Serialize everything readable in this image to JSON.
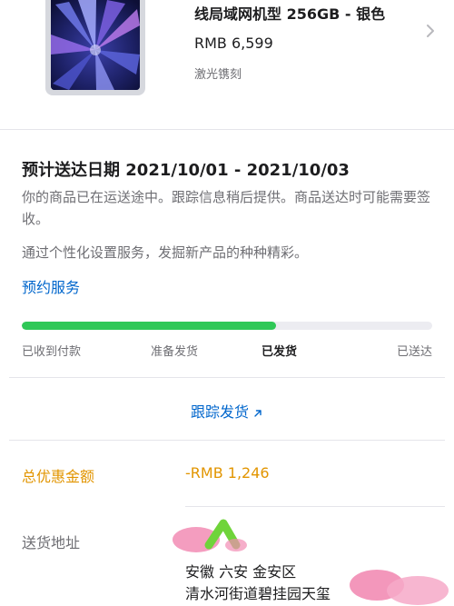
{
  "product": {
    "name": "线局域网机型 256GB - 银色",
    "price": "RMB 6,599",
    "engraving": "激光镌刻"
  },
  "delivery": {
    "title": "预计送达日期 2021/10/01 - 2021/10/03",
    "message": "你的商品已在运送途中。跟踪信息稍后提供。商品送达时可能需要签收。",
    "promo": "通过个性化设置服务，发掘新产品的种种精彩。",
    "service_link": "预约服务"
  },
  "progress": {
    "steps": [
      "已收到付款",
      "准备发货",
      "已发货",
      "已送达"
    ],
    "current_step": 2,
    "fraction": 0.62,
    "fill_color": "#2fc857"
  },
  "tracking": {
    "label": "跟踪发货"
  },
  "discount": {
    "label": "总优惠金额",
    "value": "-RMB 1,246",
    "color": "#e29500"
  },
  "address": {
    "label": "送货地址",
    "line1": "安徽 六安 金安区",
    "line2": "清水河街道碧挂园天玺"
  },
  "colors": {
    "link": "#0066cc",
    "muted": "#6e6e73"
  }
}
